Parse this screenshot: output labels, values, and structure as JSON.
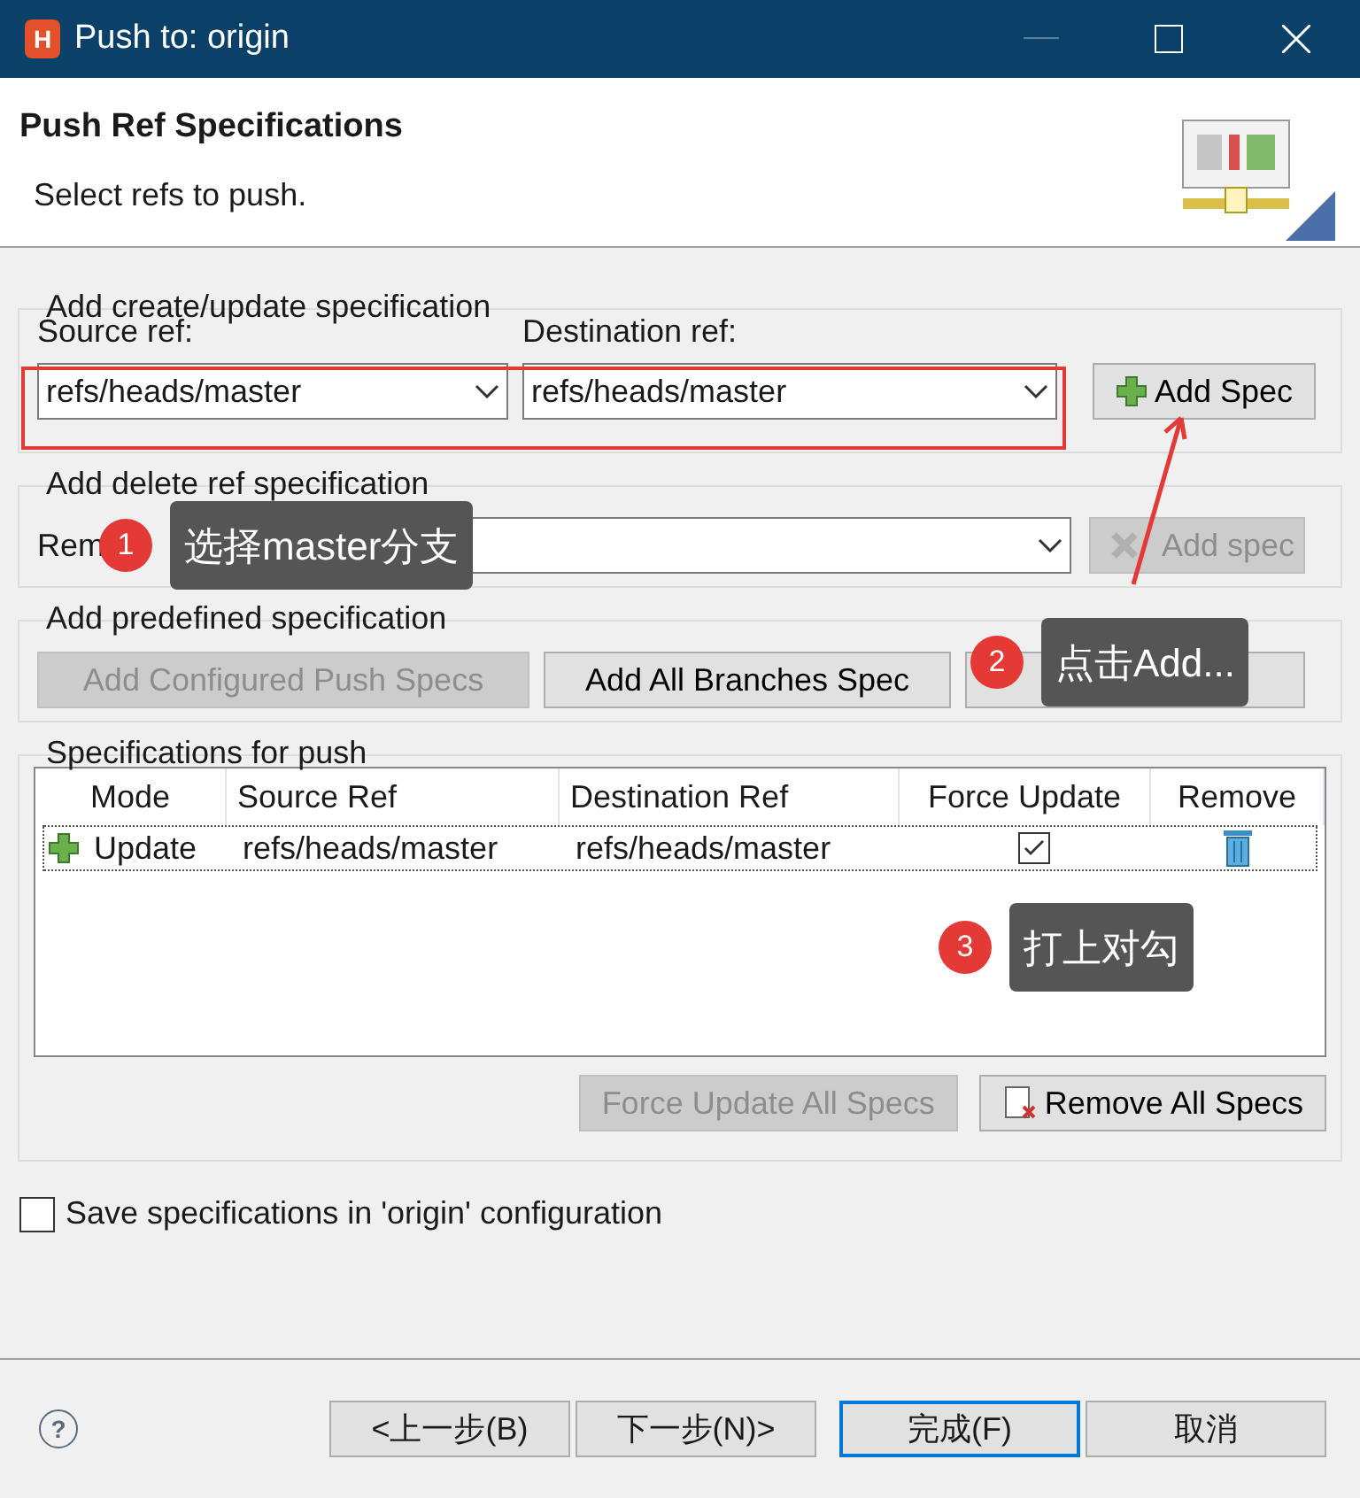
{
  "window": {
    "title": "Push to: origin",
    "app_icon": "H"
  },
  "header": {
    "title": "Push Ref Specifications",
    "subtitle": "Select refs to push."
  },
  "create_group": {
    "title": "Add create/update specification",
    "source_label": "Source ref:",
    "source_value": "refs/heads/master",
    "destination_label": "Destination ref:",
    "destination_value": "refs/heads/master",
    "button": {
      "label": "Add Spec",
      "disabled": false
    }
  },
  "delete_group": {
    "title": "Add delete ref specification",
    "label": "Rem",
    "button": {
      "label": "Add spec",
      "disabled": true
    }
  },
  "predefined_group": {
    "title": "Add predefined specification",
    "buttons": [
      {
        "label": "Add Configured Push Specs",
        "disabled": true
      },
      {
        "label": "Add All Branches Spec",
        "disabled": false
      },
      {
        "disabled": false
      }
    ]
  },
  "specs_group": {
    "title": "Specifications for push",
    "table": {
      "columns": [
        "Mode",
        "Source Ref",
        "Destination Ref",
        "Force Update",
        "Remove"
      ],
      "rows": [
        {
          "mode": "Update",
          "source": "refs/heads/master",
          "destination": "refs/heads/master",
          "force_update": true
        }
      ]
    },
    "buttons": [
      {
        "label": "Force Update All Specs",
        "disabled": true
      },
      {
        "label": "Remove All Specs",
        "disabled": false
      }
    ]
  },
  "save_checkbox": {
    "label": "Save specifications in 'origin' configuration",
    "checked": false
  },
  "help_button": "?",
  "footer_buttons": [
    {
      "label": "<上一步(B)",
      "default": false
    },
    {
      "label": "下一步(N)>",
      "default": false
    },
    {
      "label": "完成(F)",
      "default": true
    },
    {
      "label": "取消",
      "default": false
    }
  ],
  "annotations": [
    {
      "number": "1",
      "text": "选择master分支"
    },
    {
      "number": "2",
      "text": "点击Add..."
    },
    {
      "number": "3",
      "text": "打上对勾"
    }
  ]
}
